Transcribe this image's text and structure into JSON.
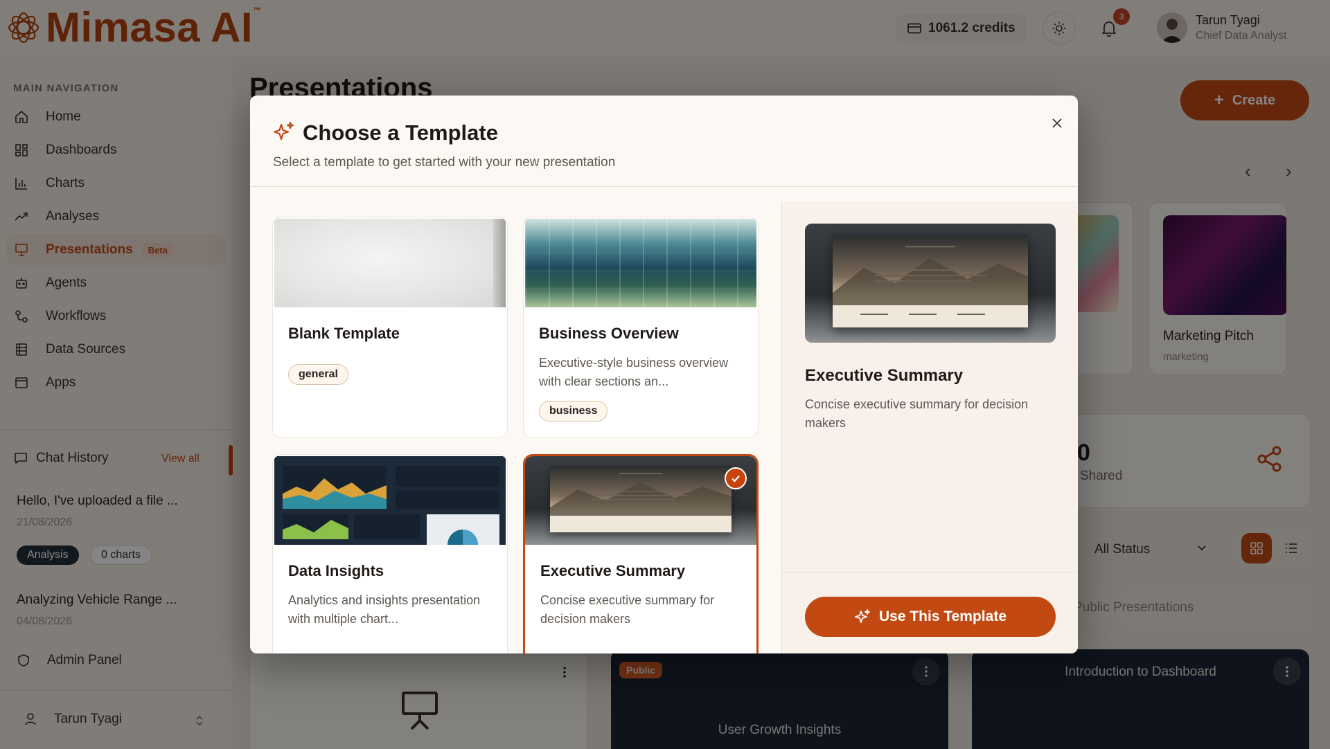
{
  "app": {
    "logo_text": "Mimasa AI",
    "logo_tm": "™",
    "brand_color": "#b3420f",
    "accent_color": "#c24a12"
  },
  "topbar": {
    "credits": "1061.2 credits",
    "notifications_count": "3",
    "user_name": "Tarun Tyagi",
    "user_role": "Chief Data Analyst"
  },
  "sidebar": {
    "heading": "MAIN NAVIGATION",
    "items": [
      {
        "label": "Home",
        "icon": "home-icon"
      },
      {
        "label": "Dashboards",
        "icon": "dashboard-grid-icon"
      },
      {
        "label": "Charts",
        "icon": "bar-chart-icon"
      },
      {
        "label": "Analyses",
        "icon": "trend-icon"
      },
      {
        "label": "Presentations",
        "icon": "presentation-icon",
        "badge": "Beta",
        "active": true
      },
      {
        "label": "Agents",
        "icon": "robot-icon"
      },
      {
        "label": "Workflows",
        "icon": "workflow-icon"
      },
      {
        "label": "Data Sources",
        "icon": "database-icon"
      },
      {
        "label": "Apps",
        "icon": "apps-window-icon"
      }
    ],
    "chat_history": {
      "title": "Chat History",
      "view_all": "View all",
      "items": [
        {
          "title": "Hello, I've uploaded a file ...",
          "date": "21/08/2026",
          "tags": [
            "Analysis",
            "0 charts"
          ]
        },
        {
          "title": "Analyzing Vehicle Range ...",
          "date": "04/08/2026"
        }
      ]
    },
    "admin_panel": "Admin Panel",
    "footer_user": "Tarun Tyagi"
  },
  "main": {
    "page_title": "Presentations",
    "create_label": "Create",
    "recent_cards": [
      {
        "title": "Marketing Pitch",
        "tag": "marketing"
      }
    ],
    "stats": {
      "value": "0",
      "label": "Shared"
    },
    "filter_status": "All Status",
    "tab_public": "Public Presentations",
    "presentations": [
      {
        "title": "",
        "public": false
      },
      {
        "title": "User Growth Insights",
        "badge": "Public"
      },
      {
        "title": "Introduction to Dashboard"
      }
    ]
  },
  "modal": {
    "title": "Choose a Template",
    "subtitle": "Select a template to get started with your new presentation",
    "templates": [
      {
        "name": "Blank Template",
        "description": "",
        "tag": "general"
      },
      {
        "name": "Business Overview",
        "description": "Executive-style business overview with clear sections an...",
        "tag": "business"
      },
      {
        "name": "Data Insights",
        "description": "Analytics and insights presentation with multiple chart..."
      },
      {
        "name": "Executive Summary",
        "description": "Concise executive summary for decision makers",
        "selected": true
      }
    ],
    "preview": {
      "title": "Executive Summary",
      "description": "Concise executive summary for decision makers"
    },
    "use_button": "Use This Template"
  }
}
